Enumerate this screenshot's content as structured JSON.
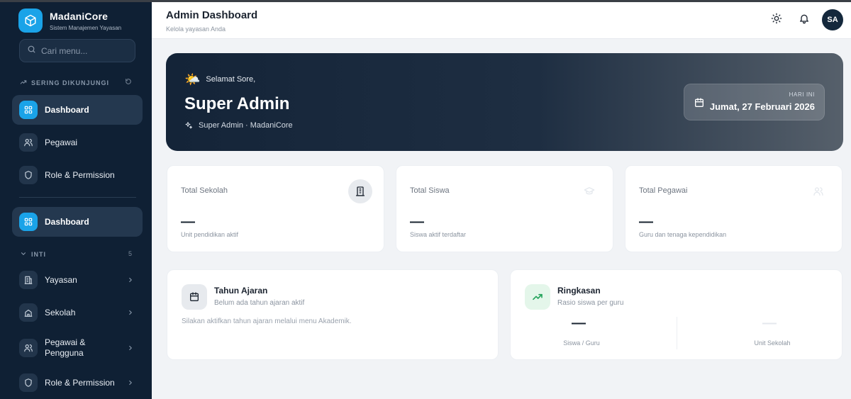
{
  "app": {
    "name": "MadaniCore",
    "subtitle": "Sistem Manajemen Yayasan"
  },
  "sidebar": {
    "search_placeholder": "Cari menu...",
    "frequent_label": "SERING DIKUNJUNGI",
    "frequent_items": [
      {
        "label": "Dashboard",
        "icon": "grid-icon",
        "active": true
      },
      {
        "label": "Pegawai",
        "icon": "users-icon",
        "active": false
      },
      {
        "label": "Role & Permission",
        "icon": "shield-icon",
        "active": false
      }
    ],
    "main_item": {
      "label": "Dashboard",
      "icon": "grid-icon",
      "active": true
    },
    "section_label": "INTI",
    "section_count": "5",
    "section_items": [
      {
        "label": "Yayasan",
        "icon": "building-icon"
      },
      {
        "label": "Sekolah",
        "icon": "school-icon"
      },
      {
        "label": "Pegawai & Pengguna",
        "icon": "users-icon"
      },
      {
        "label": "Role & Permission",
        "icon": "shield-icon"
      }
    ]
  },
  "header": {
    "title": "Admin Dashboard",
    "subtitle": "Kelola yayasan Anda",
    "avatar_initials": "SA"
  },
  "hero": {
    "greeting": "Selamat Sore,",
    "name": "Super Admin",
    "role_line": "Super Admin · MadaniCore",
    "date_label": "HARI INI",
    "date_value": "Jumat, 27 Februari 2026"
  },
  "stats": [
    {
      "title": "Total Sekolah",
      "value": "—",
      "desc": "Unit pendidikan aktif",
      "icon": "building-icon"
    },
    {
      "title": "Total Siswa",
      "value": "—",
      "desc": "Siswa aktif terdaftar",
      "icon": "graduation-cap-icon"
    },
    {
      "title": "Total Pegawai",
      "value": "—",
      "desc": "Guru dan tenaga kependidikan",
      "icon": "users-icon"
    }
  ],
  "academic_year": {
    "title": "Tahun Ajaran",
    "subtitle": "Belum ada tahun ajaran aktif",
    "text": "Silakan aktifkan tahun ajaran melalui menu Akademik."
  },
  "summary": {
    "title": "Ringkasan",
    "subtitle": "Rasio siswa per guru",
    "metrics": [
      {
        "value": "—",
        "label": "Siswa / Guru"
      },
      {
        "value": "—",
        "label": "Unit Sekolah"
      }
    ]
  },
  "colors": {
    "sidebar_bg": "#0f2034",
    "accent": "#1aa3e8",
    "hero_bg": "#142438",
    "summary_green": "#22a35a"
  }
}
